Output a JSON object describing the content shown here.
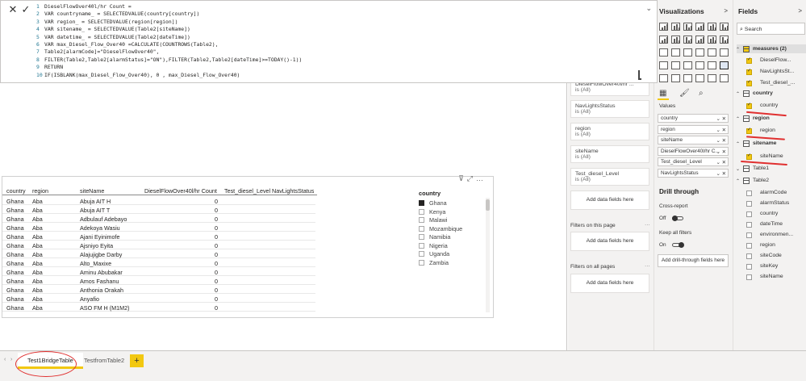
{
  "formula": {
    "lines": [
      "DieselFlowOver40l/hr Count =",
      "VAR countryname_ = SELECTEDVALUE(country[country])",
      "VAR region_ = SELECTEDVALUE(region[region])",
      "VAR sitename_ = SELECTEDVALUE(Table2[siteName])",
      "VAR datetime_ = SELECTEDVALUE(Table2[dateTime])",
      "VAR max_Diesel_Flow_Over40 =CALCULATE(COUNTROWS(Table2),",
      "Table2[alarmCode]=\"DieselFlowOver40\",",
      "FILTER(Table2,Table2[alarmStatus]=\"ON\"),FILTER(Table2,Table2[dateTime]>=TODAY()-1))",
      "RETURN",
      "IF(ISBLANK(max_Diesel_Flow_Over40), 0 , max_Diesel_Flow_Over40)"
    ],
    "line_numbers": [
      "1",
      "2",
      "3",
      "4",
      "5",
      "6",
      "7",
      "8",
      "9",
      "10"
    ]
  },
  "table": {
    "headers": [
      "country",
      "region",
      "siteName",
      "DieselFlowOver40l/hr Count",
      "Test_diesel_Level",
      "NavLightsStatus"
    ],
    "rows": [
      [
        "Ghana",
        "Aba",
        "Abuja AIT H",
        "0"
      ],
      [
        "Ghana",
        "Aba",
        "Abuja AIT T",
        "0"
      ],
      [
        "Ghana",
        "Aba",
        "Adbulauf Adebayo",
        "0"
      ],
      [
        "Ghana",
        "Aba",
        "Adekoya Wasiu",
        "0"
      ],
      [
        "Ghana",
        "Aba",
        "Ajani Eyinimofe",
        "0"
      ],
      [
        "Ghana",
        "Aba",
        "Ajsniyo Eyita",
        "0"
      ],
      [
        "Ghana",
        "Aba",
        "Alajujigbe Darby",
        "0"
      ],
      [
        "Ghana",
        "Aba",
        "Alto_Maxixe",
        "0"
      ],
      [
        "Ghana",
        "Aba",
        "Aminu Abubakar",
        "0"
      ],
      [
        "Ghana",
        "Aba",
        "Amos Fashanu",
        "0"
      ],
      [
        "Ghana",
        "Aba",
        "Anthonia Orakah",
        "0"
      ],
      [
        "Ghana",
        "Aba",
        "Anyafio",
        "0"
      ],
      [
        "Ghana",
        "Aba",
        "ASO FM H (M1M2)",
        "0"
      ]
    ]
  },
  "slicer": {
    "title": "country",
    "items": [
      {
        "label": "Ghana",
        "checked": true
      },
      {
        "label": "Kenya",
        "checked": false
      },
      {
        "label": "Malawi",
        "checked": false
      },
      {
        "label": "Mozambique",
        "checked": false
      },
      {
        "label": "Namibia",
        "checked": false
      },
      {
        "label": "Nigeria",
        "checked": false
      },
      {
        "label": "Uganda",
        "checked": false
      },
      {
        "label": "Zambia",
        "checked": false
      }
    ]
  },
  "tabs": {
    "items": [
      "Test1BridgeTable",
      "TestfromTable2"
    ],
    "add": "+"
  },
  "filters": {
    "cards": [
      {
        "name": "DieselFlowOver40l/hr ...",
        "value": "is (All)"
      },
      {
        "name": "NavLightsStatus",
        "value": "is (All)"
      },
      {
        "name": "region",
        "value": "is (All)"
      },
      {
        "name": "siteName",
        "value": "is (All)"
      },
      {
        "name": "Test_diesel_Level",
        "value": "is (All)"
      }
    ],
    "add_label": "Add data fields here",
    "page_section": "Filters on this page",
    "all_section": "Filters on all pages",
    "more": "···"
  },
  "viz": {
    "title": "Visualizations",
    "chevron": ">",
    "values_label": "Values",
    "wells": [
      "country",
      "region",
      "siteName",
      "DieselFlowOver40l/hr C...",
      "Test_diesel_Level",
      "NavLightsStatus"
    ],
    "remove": "✕",
    "drill_title": "Drill through",
    "cross_report": "Cross-report",
    "off_label": "Off",
    "keep_filters": "Keep all filters",
    "on_label": "On",
    "drill_add": "Add drill-through fields here"
  },
  "fields": {
    "title": "Fields",
    "chevron": ">",
    "search_placeholder": "Search",
    "measures": {
      "name": "measures (2)",
      "items": [
        "DieselFlow...",
        "NavLightsSt...",
        "Test_diesel_..."
      ]
    },
    "country": {
      "name": "country",
      "items": [
        "country"
      ]
    },
    "region": {
      "name": "region",
      "items": [
        "region"
      ]
    },
    "sitename": {
      "name": "sitename",
      "items": [
        "siteName"
      ]
    },
    "table1": "Table1",
    "table2": {
      "name": "Table2",
      "items": [
        "alarmCode",
        "alarmStatus",
        "country",
        "dateTime",
        "environmen...",
        "region",
        "siteCode",
        "siteKey",
        "siteName"
      ]
    }
  },
  "colors": {
    "accent": "#f2c811",
    "annotation": "#e03030"
  }
}
